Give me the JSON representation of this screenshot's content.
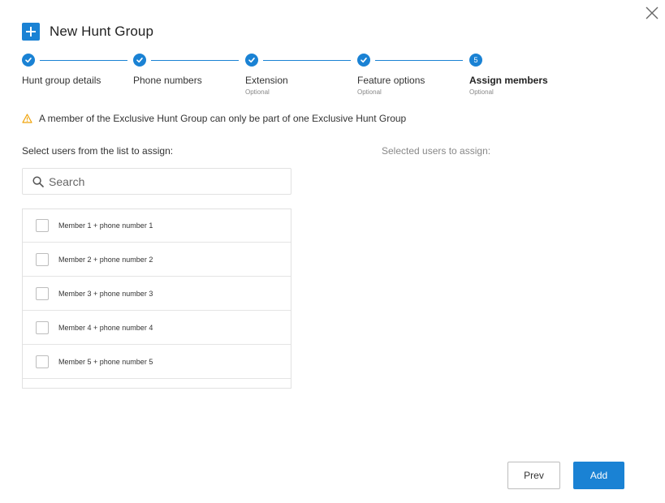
{
  "header": {
    "title": "New Hunt Group",
    "icon": "plus-icon",
    "accent": "#1a82d4"
  },
  "close": {
    "icon": "close-icon"
  },
  "stepper": {
    "steps": [
      {
        "number": "1",
        "label": "Hunt group details",
        "sublabel": "",
        "status": "complete"
      },
      {
        "number": "2",
        "label": "Phone numbers",
        "sublabel": "",
        "status": "complete"
      },
      {
        "number": "3",
        "label": "Extension",
        "sublabel": "Optional",
        "status": "complete"
      },
      {
        "number": "4",
        "label": "Feature options",
        "sublabel": "Optional",
        "status": "complete"
      },
      {
        "number": "5",
        "label": "Assign members",
        "sublabel": "Optional",
        "status": "current"
      }
    ]
  },
  "warning": {
    "icon": "warning-icon",
    "color": "#f0a30a",
    "text": "A member of the Exclusive Hunt Group can only be part of one Exclusive Hunt Group"
  },
  "left_panel": {
    "label": "Select users from the list to assign:",
    "search_placeholder": "Search",
    "members": [
      {
        "label": "Member 1 + phone number 1",
        "checked": false
      },
      {
        "label": "Member 2 + phone number 2",
        "checked": false
      },
      {
        "label": "Member 3 + phone number 3",
        "checked": false
      },
      {
        "label": "Member 4 + phone number 4",
        "checked": false
      },
      {
        "label": "Member 5 + phone number 5",
        "checked": false
      }
    ]
  },
  "right_panel": {
    "label": "Selected users to assign:"
  },
  "footer": {
    "prev_label": "Prev",
    "add_label": "Add"
  }
}
